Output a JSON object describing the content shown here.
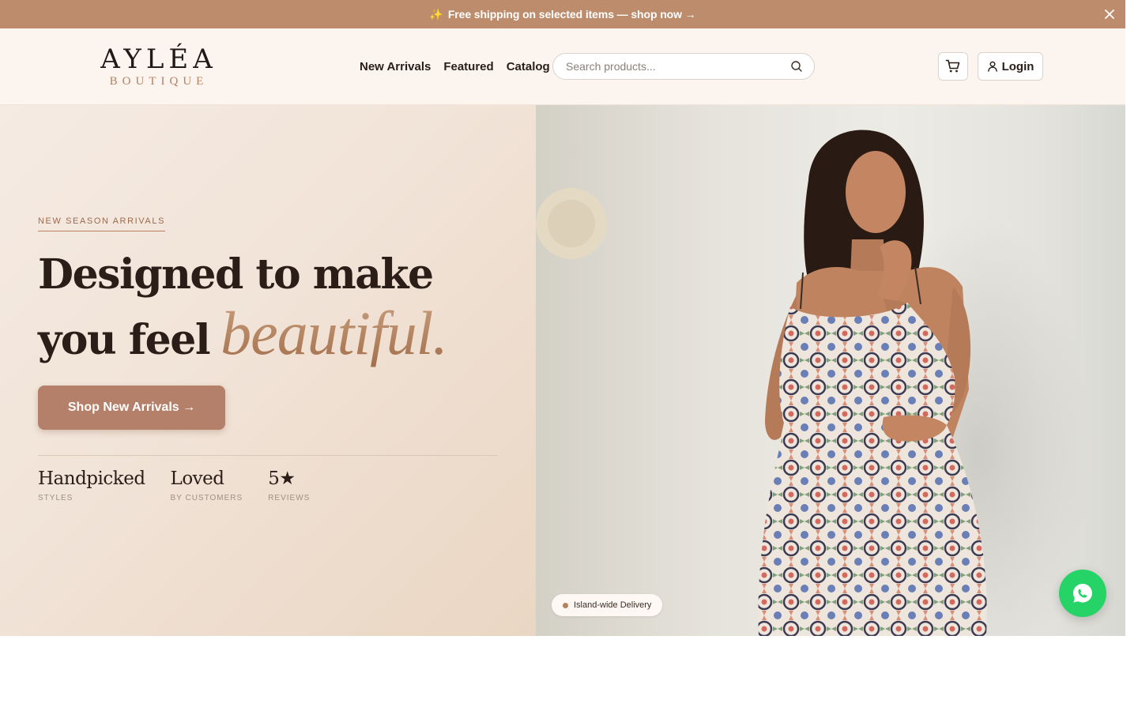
{
  "announcement": {
    "icon": "sparkles-icon",
    "text": "Free shipping on selected items — shop now →",
    "background": "#bd8c6c"
  },
  "header": {
    "logo_main": "AYLÉA",
    "logo_sub": "BOUTIQUE",
    "nav": [
      {
        "label": "New Arrivals"
      },
      {
        "label": "Featured"
      },
      {
        "label": "Catalog"
      }
    ],
    "search_placeholder": "Search products...",
    "login_label": "Login"
  },
  "hero": {
    "eyebrow": "NEW SEASON ARRIVALS",
    "headline_line1": "Designed to make",
    "headline_line2": "you feel",
    "headline_accent": "beautiful.",
    "cta_label": "Shop New Arrivals →",
    "stats": [
      {
        "value": "Handpicked",
        "label": "STYLES"
      },
      {
        "value": "Loved",
        "label": "BY CUSTOMERS"
      },
      {
        "value": "5★",
        "label": "REVIEWS"
      }
    ],
    "badge": "Island-wide Delivery"
  },
  "colors": {
    "accent": "#b4806a",
    "whatsapp": "#25d366"
  }
}
